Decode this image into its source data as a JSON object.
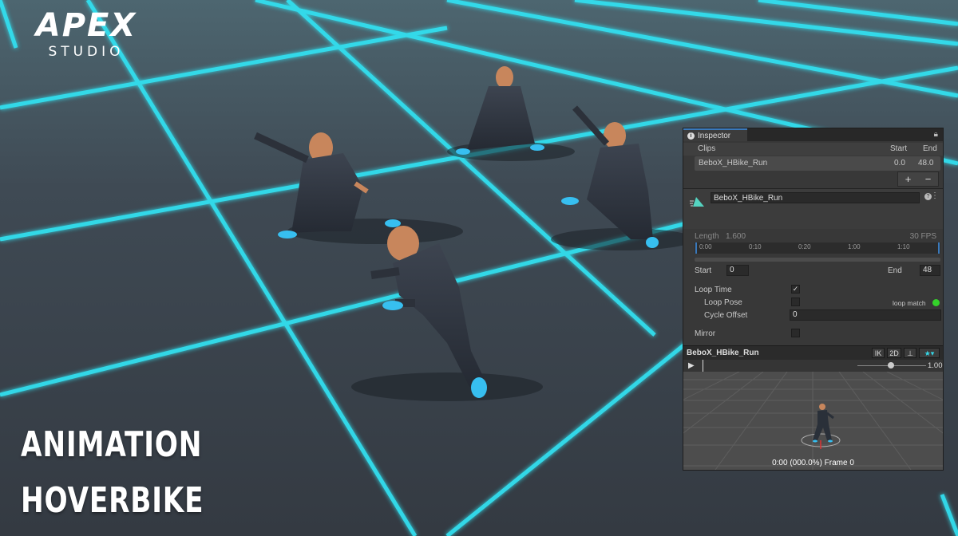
{
  "brand": {
    "name": "APEX",
    "sub": "STUDIO"
  },
  "title": {
    "line1": "ANIMATION",
    "line2": "HOVERBIKE"
  },
  "colors": {
    "grid_glow": "#31e0f0",
    "floor": "#3a4048",
    "panel": "#383838",
    "accent": "#3a79bb",
    "loop_ok": "#34d22a"
  },
  "inspector": {
    "tab_label": "Inspector",
    "icons": {
      "tab": "info-icon",
      "lock": "lock-icon",
      "help": "help-icon",
      "menu": "kebab-icon"
    },
    "clips": {
      "header": "Clips",
      "start_header": "Start",
      "end_header": "End",
      "rows": [
        {
          "name": "BeboX_HBike_Run",
          "start": "0.0",
          "end": "48.0"
        }
      ],
      "add_label": "+",
      "remove_label": "−"
    },
    "animation_name": "BeboX_HBike_Run",
    "length_label": "Length",
    "length_value": "1.600",
    "fps": "30 FPS",
    "timeline_ticks": [
      "0:00",
      "0:10",
      "0:20",
      "1:00",
      "1:10"
    ],
    "start_label": "Start",
    "start_value": "0",
    "end_label": "End",
    "end_value": "48",
    "loop_time_label": "Loop Time",
    "loop_time_checked": true,
    "loop_pose_label": "Loop Pose",
    "loop_pose_checked": false,
    "loop_match_label": "loop match",
    "cycle_offset_label": "Cycle Offset",
    "cycle_offset_value": "0",
    "mirror_label": "Mirror",
    "mirror_checked": false
  },
  "preview": {
    "clip_name": "BeboX_HBike_Run",
    "ik_label": "IK",
    "twod_label": "2D",
    "speed": "1.00",
    "frame_text": "0:00 (000.0%) Frame 0"
  }
}
